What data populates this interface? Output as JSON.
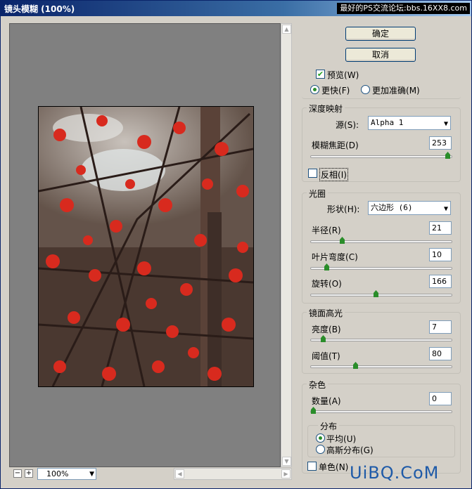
{
  "window": {
    "title": "镜头模糊 (100%)",
    "watermark_top": "最好的PS交流论坛:bbs.16XX8.com",
    "watermark_bottom": "UiBQ.CoM"
  },
  "buttons": {
    "ok": "确定",
    "cancel": "取消"
  },
  "preview": {
    "checkbox_label": "预览",
    "checkbox_key": "(W)",
    "checked": true,
    "radio_fast": "更快",
    "radio_fast_key": "(F)",
    "radio_accurate": "更加准确",
    "radio_accurate_key": "(M)"
  },
  "depth_map": {
    "legend": "深度映射",
    "source_label": "源",
    "source_key": "(S)",
    "source_value": "Alpha 1",
    "blur_focal_label": "模糊焦距",
    "blur_focal_key": "(D)",
    "blur_focal_value": "253",
    "blur_focal_max": 255,
    "invert_label": "反相",
    "invert_key": "(I)"
  },
  "iris": {
    "legend": "光圈",
    "shape_label": "形状",
    "shape_key": "(H)",
    "shape_value": "六边形 (6)",
    "radius_label": "半径",
    "radius_key": "(R)",
    "radius_value": "21",
    "curvature_label": "叶片弯度",
    "curvature_key": "(C)",
    "curvature_value": "10",
    "rotation_label": "旋转",
    "rotation_key": "(O)",
    "rotation_value": "166"
  },
  "specular": {
    "legend": "镜面高光",
    "brightness_label": "亮度",
    "brightness_key": "(B)",
    "brightness_value": "7",
    "threshold_label": "阈值",
    "threshold_key": "(T)",
    "threshold_value": "80"
  },
  "noise": {
    "legend": "杂色",
    "amount_label": "数量",
    "amount_key": "(A)",
    "amount_value": "0",
    "distribution_legend": "分布",
    "uniform_label": "平均",
    "uniform_key": "(U)",
    "gaussian_label": "高斯分布",
    "gaussian_key": "(G)",
    "mono_label": "单色",
    "mono_key": "(N)"
  },
  "zoom": {
    "value": "100%"
  },
  "sliders": {
    "blur_focal": 0.99,
    "radius": 0.21,
    "curvature": 0.1,
    "rotation": 0.46,
    "brightness": 0.07,
    "threshold": 0.31,
    "amount": 0.0
  },
  "colors": {
    "accent": "#2a8d2a",
    "titlebar": "#0a246a"
  }
}
